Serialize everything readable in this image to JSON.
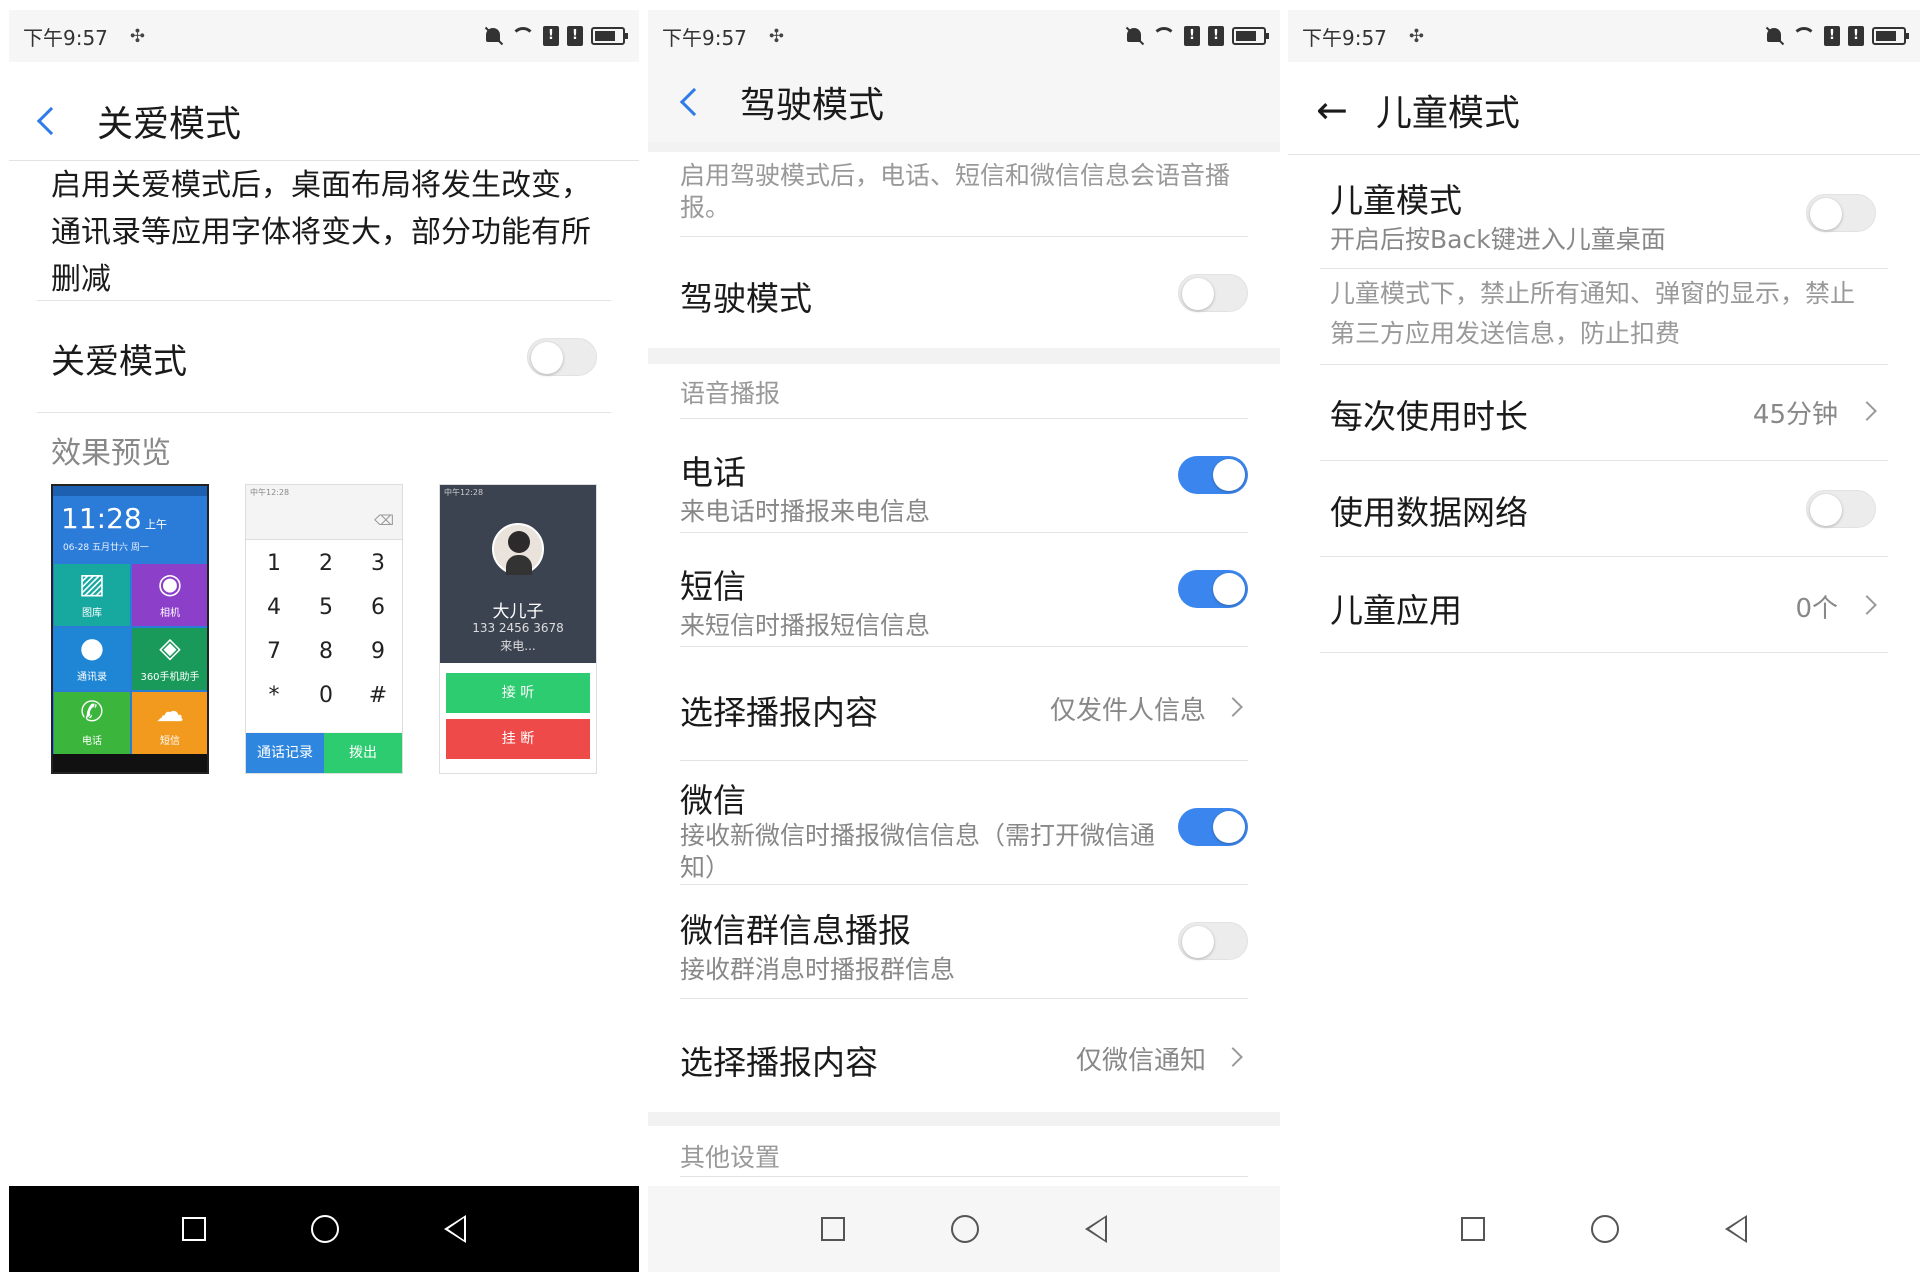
{
  "status_time": "下午9:57",
  "panel1": {
    "title": "关爱模式",
    "description": "启用关爱模式后，桌面布局将发生改变，通讯录等应用字体将变大，部分功能有所删减",
    "toggle_label": "关爱模式",
    "toggle_on": false,
    "preview_heading": "效果预览",
    "preview_home": {
      "clock": "11:28",
      "ampm": "上午",
      "date": "06-28 五月廿六 周一",
      "tiles": [
        "图库",
        "相机",
        "通讯录",
        "360手机助手",
        "电话",
        "短信"
      ]
    },
    "preview_dialer": {
      "status": "中午12:28",
      "keys": [
        "1",
        "2",
        "3",
        "4",
        "5",
        "6",
        "7",
        "8",
        "9",
        "*",
        "0",
        "#"
      ],
      "btn_log": "通话记录",
      "btn_dial": "拨出"
    },
    "preview_call": {
      "status": "中午12:28",
      "name": "大儿子",
      "number": "133 2456 3678",
      "state": "来电...",
      "answer": "接 听",
      "hangup": "挂 断"
    }
  },
  "panel2": {
    "title": "驾驶模式",
    "description": "启用驾驶模式后，电话、短信和微信信息会语音播报。",
    "driving_label": "驾驶模式",
    "driving_on": false,
    "section_voice": "语音播报",
    "items": [
      {
        "label": "电话",
        "sub": "来电话时播报来电信息",
        "on": true
      },
      {
        "label": "短信",
        "sub": "来短信时播报短信信息",
        "on": true
      }
    ],
    "select1_label": "选择播报内容",
    "select1_value": "仅发件人信息",
    "wechat_label": "微信",
    "wechat_sub": "接收新微信时播报微信信息（需打开微信通知）",
    "wechat_on": true,
    "group_label": "微信群信息播报",
    "group_sub": "接收群消息时播报群信息",
    "group_on": false,
    "select2_label": "选择播报内容",
    "select2_value": "仅微信通知",
    "section_other": "其他设置"
  },
  "panel3": {
    "title": "儿童模式",
    "kids_label": "儿童模式",
    "kids_sub": "开启后按Back键进入儿童桌面",
    "kids_on": false,
    "kids_note": "儿童模式下，禁止所有通知、弹窗的显示，禁止第三方应用发送信息，防止扣费",
    "duration_label": "每次使用时长",
    "duration_value": "45分钟",
    "data_label": "使用数据网络",
    "data_on": false,
    "apps_label": "儿童应用",
    "apps_value": "0个"
  },
  "colors": {
    "accent": "#2f7bea",
    "toggle_on": "#3b86ee",
    "answer": "#2ecc71",
    "hangup": "#ef4a4a",
    "call_bg": "#3b4250"
  }
}
